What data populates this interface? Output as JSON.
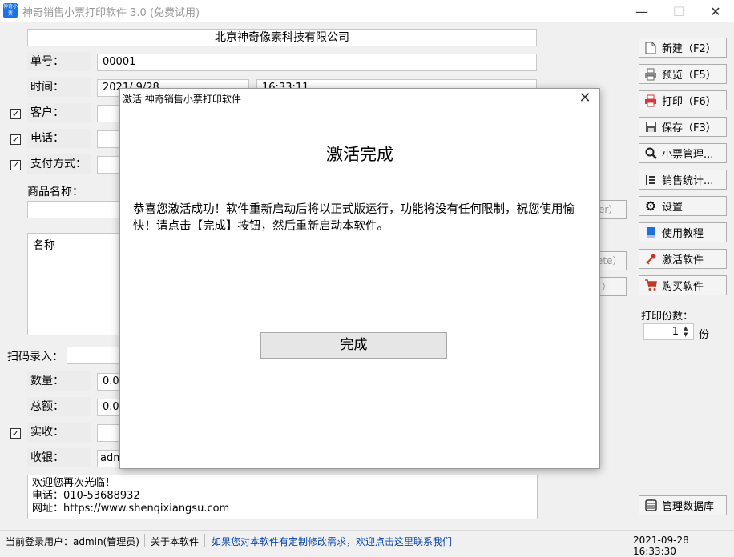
{
  "window": {
    "title": "神奇销售小票打印软件 3.0 (免费试用)",
    "app_icon_text": "神奇小票",
    "minimize": "—",
    "maximize": "☐",
    "close": "✕"
  },
  "form": {
    "company": "北京神奇像素科技有限公司",
    "order_no_label": "单号：",
    "order_no": "00001",
    "time_label": "时间：",
    "date_value": "2021/ 9/28",
    "time_value": "16:33:11",
    "customer_label": "客户：",
    "phone_label": "电话：",
    "payment_label": "支付方式：",
    "product_name_label": "商品名称：",
    "table_header_name": "名称",
    "scan_label": "扫码录入：",
    "quantity_label": "数量：",
    "quantity_value": "0.00",
    "total_label": "总额：",
    "total_value": "0.00",
    "paid_label": "实收：",
    "cashier_label": "收银：",
    "cashier_value": "adm",
    "partial_btn_1": "er）",
    "partial_btn_2": "ete）",
    "partial_btn_3": "）",
    "checkmark": "✓",
    "footer_lines": [
      "欢迎您再次光临！",
      "电话：010-53688932",
      "网址：https://www.shenqixiangsu.com"
    ]
  },
  "toolbar": {
    "new": "新建（F2）",
    "preview": "预览（F5）",
    "print": "打印（F6）",
    "save": "保存（F3）",
    "manage_receipts": "小票管理...",
    "sales_stats": "销售统计...",
    "settings": "设置",
    "tutorial": "使用教程",
    "activate": "激活软件",
    "buy": "购买软件",
    "copies_label": "打印份数：",
    "copies_value": "1",
    "copies_unit": "份",
    "manage_db": "管理数据库"
  },
  "icons": {
    "new": "new-document-icon",
    "preview": "printer-preview-icon",
    "print": "printer-icon",
    "save": "floppy-disk-icon",
    "manage_receipts": "magnifier-icon",
    "sales_stats": "list-icon",
    "settings": "gear-icon",
    "tutorial": "book-icon",
    "activate": "key-icon",
    "buy": "shopping-cart-icon",
    "manage_db": "database-icon"
  },
  "dialog": {
    "title": "激活 神奇销售小票打印软件",
    "close": "✕",
    "heading": "激活完成",
    "message": "恭喜您激活成功！软件重新启动后将以正式版运行，功能将没有任何限制，祝您使用愉快！请点击【完成】按钮，然后重新启动本软件。",
    "ok_button": "完成"
  },
  "statusbar": {
    "current_user": "当前登录用户：admin(管理员)",
    "about": "关于本软件",
    "custom_link": "如果您对本软件有定制修改需求，欢迎点击这里联系我们",
    "datetime": "2021-09-28 16:33:30"
  },
  "colors": {
    "link": "#0645ad",
    "print_icon": "#d9363e",
    "tutorial_icon": "#1e6fd9",
    "activate_icon": "#c0392b",
    "buy_icon": "#c0392b"
  }
}
